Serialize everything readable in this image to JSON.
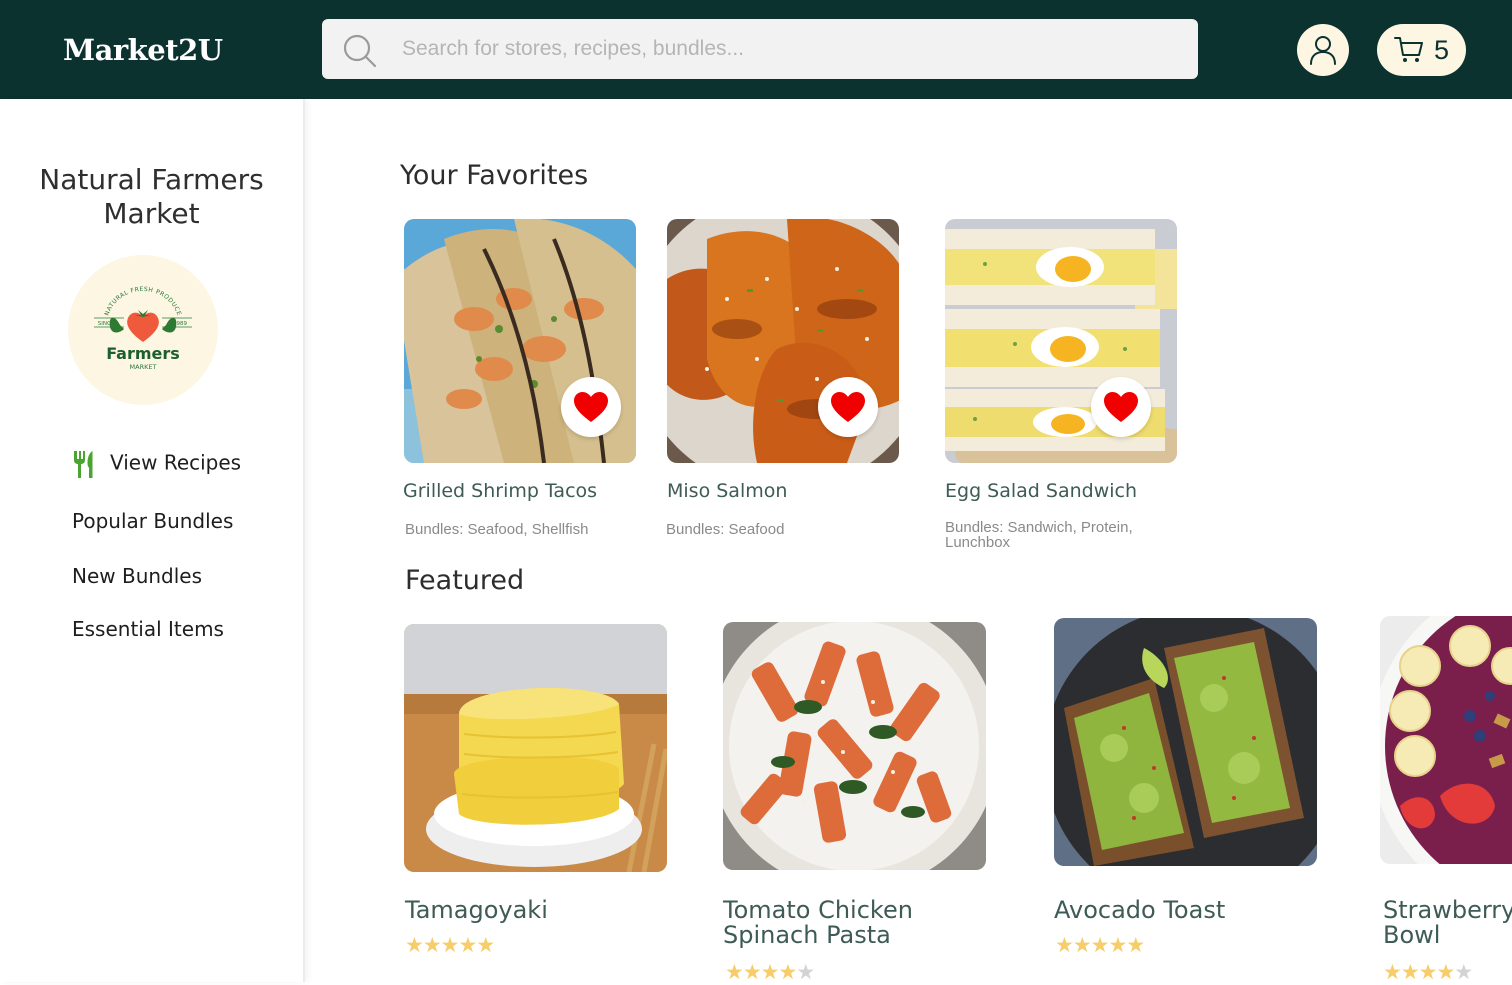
{
  "header": {
    "logo": "Market2U",
    "search_placeholder": "Search for stores, recipes, bundles...",
    "cart_count": "5",
    "brand_color": "#0c3230",
    "button_bg": "#fcf6e3"
  },
  "sidebar": {
    "store_name": "Natural Farmers Market",
    "store_logo": {
      "arc_text": "NATURAL FRESH PRODUCE",
      "since": "SINCE",
      "year": "1989",
      "name": "Farmers",
      "sub": "MARKET"
    },
    "items": [
      {
        "label": "View Recipes",
        "icon": "fork-knife-icon"
      },
      {
        "label": "Popular Bundles"
      },
      {
        "label": "New Bundles"
      },
      {
        "label": "Essential Items"
      }
    ]
  },
  "favorites": {
    "title": "Your Favorites",
    "items": [
      {
        "name": "Grilled Shrimp Tacos",
        "bundles": "Bundles: Seafood, Shellfish",
        "favorited": true
      },
      {
        "name": "Miso Salmon",
        "bundles": "Bundles: Seafood",
        "favorited": true
      },
      {
        "name": "Egg Salad Sandwich",
        "bundles": "Bundles: Sandwich, Protein, Lunchbox",
        "favorited": true
      }
    ]
  },
  "featured": {
    "title": "Featured",
    "items": [
      {
        "name": "Tamagoyaki",
        "rating": 5
      },
      {
        "name": "Tomato Chicken Spinach Pasta",
        "rating": 4
      },
      {
        "name": "Avocado Toast",
        "rating": 5
      },
      {
        "name": "Strawberry Acai Bowl",
        "rating": 4
      }
    ]
  }
}
